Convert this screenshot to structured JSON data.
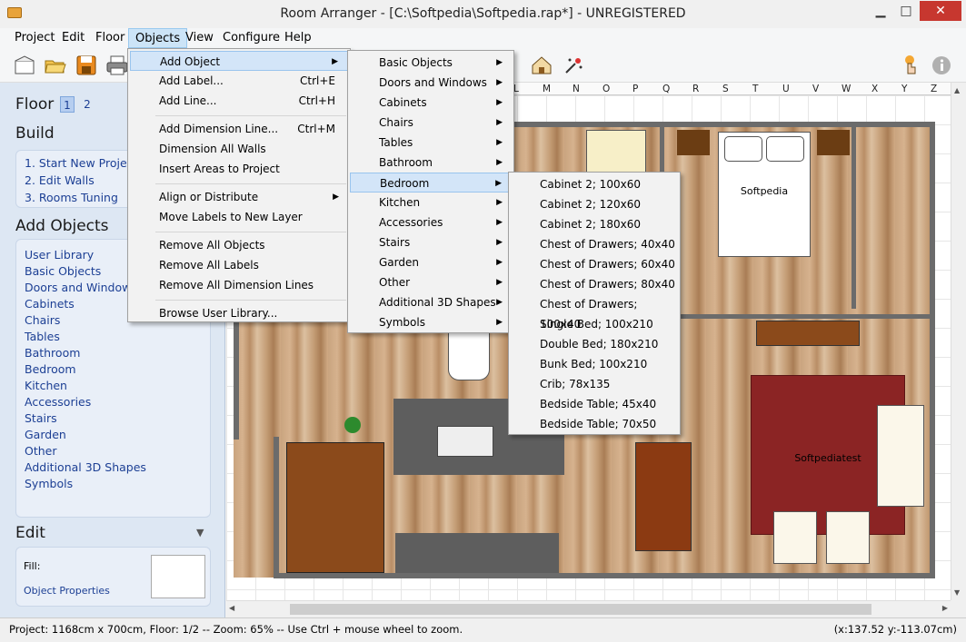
{
  "window": {
    "title": "Room Arranger - [C:\\Softpedia\\Softpedia.rap*] - UNREGISTERED",
    "close": "✕",
    "minimize": "▁",
    "maximize": "□"
  },
  "menubar": {
    "items": [
      "Project",
      "Edit",
      "Floor",
      "Objects",
      "View",
      "Configure",
      "Help"
    ]
  },
  "toolbar": {
    "icons": [
      "new-icon",
      "open-icon",
      "save-icon",
      "print-icon",
      "house-icon",
      "magic-icon",
      "help-pointer-icon",
      "info-icon"
    ]
  },
  "sidebar": {
    "floor_title": "Floor",
    "floor_tabs": [
      "1",
      "2"
    ],
    "build_title": "Build",
    "build_items": [
      "1. Start New Project",
      "2. Edit Walls",
      "3. Rooms Tuning"
    ],
    "add_objects_title": "Add Objects",
    "add_objects_items": [
      "User Library",
      "Basic Objects",
      "Doors and Windows",
      "Cabinets",
      "Chairs",
      "Tables",
      "Bathroom",
      "Bedroom",
      "Kitchen",
      "Accessories",
      "Stairs",
      "Garden",
      "Other",
      "Additional 3D Shapes",
      "Symbols"
    ],
    "edit_title": "Edit",
    "edit_toggle": "▼",
    "fill_label": "Fill:",
    "object_properties": "Object Properties"
  },
  "ruler": {
    "labels": [
      "L",
      "M",
      "N",
      "O",
      "P",
      "Q",
      "R",
      "S",
      "T",
      "U",
      "V",
      "W",
      "X",
      "Y",
      "Z"
    ]
  },
  "canvas": {
    "room_labels": [
      "Softpedia",
      "Softpediatest"
    ]
  },
  "objects_menu": {
    "items": [
      {
        "label": "Add Object",
        "shortcut": "",
        "submenu": true
      },
      {
        "label": "Add Label...",
        "shortcut": "Ctrl+E",
        "submenu": false
      },
      {
        "label": "Add Line...",
        "shortcut": "Ctrl+H",
        "submenu": false
      },
      {
        "label": "Add Dimension Line...",
        "shortcut": "Ctrl+M",
        "submenu": false
      },
      {
        "label": "Dimension All Walls",
        "shortcut": "",
        "submenu": false
      },
      {
        "label": "Insert Areas to Project",
        "shortcut": "",
        "submenu": false
      },
      {
        "label": "Align or Distribute",
        "shortcut": "",
        "submenu": true
      },
      {
        "label": "Move Labels to New Layer",
        "shortcut": "",
        "submenu": false
      },
      {
        "label": "Remove All Objects",
        "shortcut": "",
        "submenu": false
      },
      {
        "label": "Remove All Labels",
        "shortcut": "",
        "submenu": false
      },
      {
        "label": "Remove All Dimension Lines",
        "shortcut": "",
        "submenu": false
      },
      {
        "label": "Browse User Library...",
        "shortcut": "",
        "submenu": false
      }
    ]
  },
  "add_object_menu": {
    "items": [
      "Basic Objects",
      "Doors and Windows",
      "Cabinets",
      "Chairs",
      "Tables",
      "Bathroom",
      "Bedroom",
      "Kitchen",
      "Accessories",
      "Stairs",
      "Garden",
      "Other",
      "Additional 3D Shapes",
      "Symbols"
    ]
  },
  "bedroom_menu": {
    "items": [
      "Cabinet 2; 100x60",
      "Cabinet 2; 120x60",
      "Cabinet 2; 180x60",
      "Chest of Drawers; 40x40",
      "Chest of Drawers; 60x40",
      "Chest of Drawers; 80x40",
      "Chest of Drawers; 100x40",
      "Single Bed; 100x210",
      "Double Bed; 180x210",
      "Bunk Bed; 100x210",
      "Crib; 78x135",
      "Bedside Table; 45x40",
      "Bedside Table; 70x50"
    ]
  },
  "status": {
    "left": "Project: 1168cm x 700cm, Floor: 1/2 -- Zoom: 65% -- Use Ctrl + mouse wheel to zoom.",
    "right": "(x:137.52 y:-113.07cm)"
  },
  "colors": {
    "accent": "#1c3f94",
    "highlight": "#d3e5f8",
    "carpet": "#8b2424",
    "wall": "#6b6b6b"
  }
}
